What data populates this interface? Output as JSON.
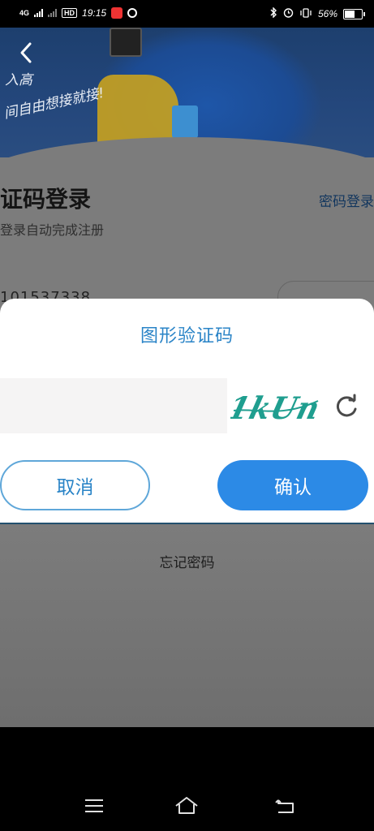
{
  "status_bar": {
    "network": "4G",
    "hd": "HD",
    "time": "19:15",
    "battery": "56%",
    "battery_level": 0.56
  },
  "hero": {
    "slogan_line1": "入高",
    "slogan_line2": "间自由想接就接!"
  },
  "login": {
    "title": "证码登录",
    "password_login_link": "密码登录",
    "subtitle": "登录自动完成注册",
    "phone_partial": "101537338",
    "forgot_password": "忘记密码"
  },
  "captcha_dialog": {
    "title": "图形验证码",
    "input_value": "",
    "captcha_text": "1kUn",
    "cancel_label": "取消",
    "confirm_label": "确认"
  },
  "icons": {
    "back": "chevron-left-icon",
    "refresh": "refresh-icon",
    "bluetooth": "bluetooth-icon",
    "alarm": "alarm-icon",
    "vibrate": "vibrate-icon",
    "menu": "menu-icon",
    "home": "home-icon",
    "back_nav": "back-arrow-icon"
  },
  "colors": {
    "accent": "#2c8ae6",
    "title_blue": "#2a84c7",
    "captcha_teal": "#1f9e8f"
  }
}
